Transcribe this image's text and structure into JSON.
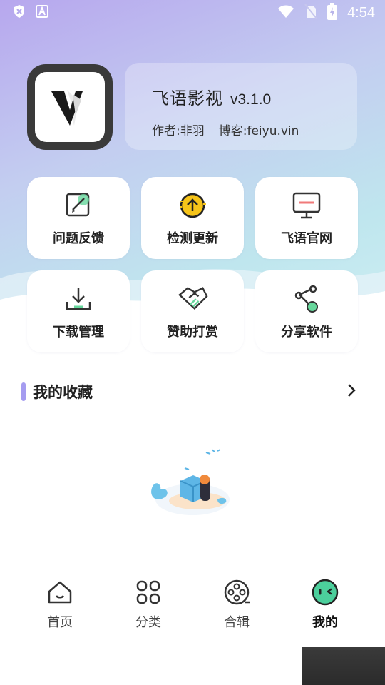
{
  "status_bar": {
    "time": "4:54",
    "left_icons": [
      "shield-icon",
      "font-icon"
    ],
    "right_icons": [
      "wifi-icon",
      "no-sim-icon",
      "battery-charging-icon"
    ]
  },
  "profile": {
    "app_name": "飞语影视",
    "version": "v3.1.0",
    "author": "作者:非羽",
    "blog": "博客:feiyu.vin",
    "logo_letter": "V"
  },
  "grid": {
    "items": [
      {
        "label": "问题反馈",
        "icon": "feedback-icon"
      },
      {
        "label": "检测更新",
        "icon": "update-icon"
      },
      {
        "label": "飞语官网",
        "icon": "website-icon"
      },
      {
        "label": "下载管理",
        "icon": "download-icon"
      },
      {
        "label": "赞助打赏",
        "icon": "sponsor-icon"
      },
      {
        "label": "分享软件",
        "icon": "share-icon"
      }
    ]
  },
  "favorites": {
    "title": "我的收藏",
    "more_icon": "chevron-right-icon"
  },
  "bottom_nav": {
    "items": [
      {
        "label": "首页",
        "icon": "home-icon",
        "active": false
      },
      {
        "label": "分类",
        "icon": "category-icon",
        "active": false
      },
      {
        "label": "合辑",
        "icon": "film-reel-icon",
        "active": false
      },
      {
        "label": "我的",
        "icon": "mine-face-icon",
        "active": true
      }
    ]
  },
  "colors": {
    "accent": "#a59cf0",
    "active_nav": "#4ccf9c",
    "update_yellow": "#f6c419",
    "website_red": "#f07a7a",
    "green": "#67d79c"
  }
}
